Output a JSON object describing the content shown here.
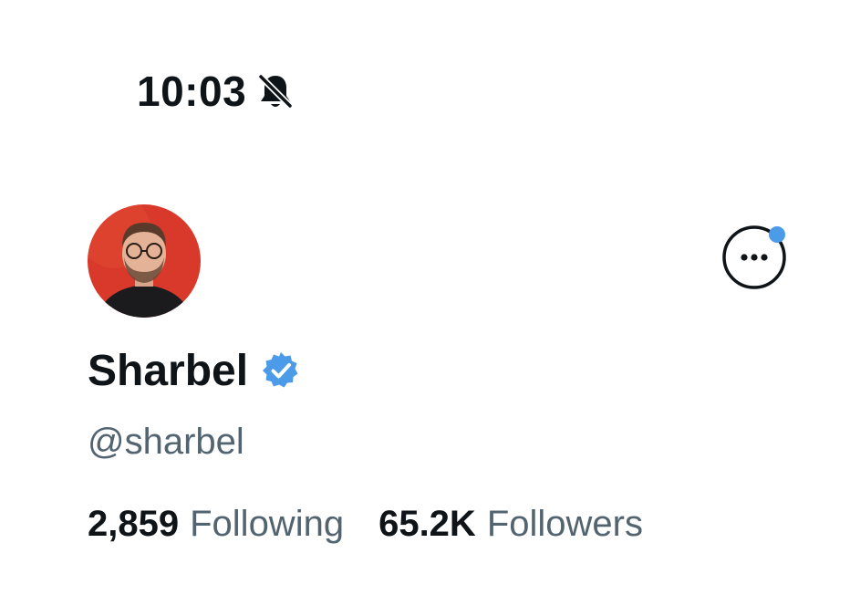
{
  "status_bar": {
    "time": "10:03",
    "bell_icon": "bell-slash-icon"
  },
  "profile": {
    "display_name": "Sharbel",
    "verified_icon": "verified-badge-icon",
    "handle": "@sharbel",
    "avatar_icon": "avatar"
  },
  "more_button": {
    "icon": "more-dots-icon",
    "has_notification_dot": true
  },
  "stats": {
    "following_value": "2,859",
    "following_label": "Following",
    "followers_value": "65.2K",
    "followers_label": "Followers"
  },
  "colors": {
    "text_primary": "#0f1419",
    "text_secondary": "#536471",
    "verified_blue": "#4b9be8",
    "avatar_bg": "#d8392b"
  }
}
